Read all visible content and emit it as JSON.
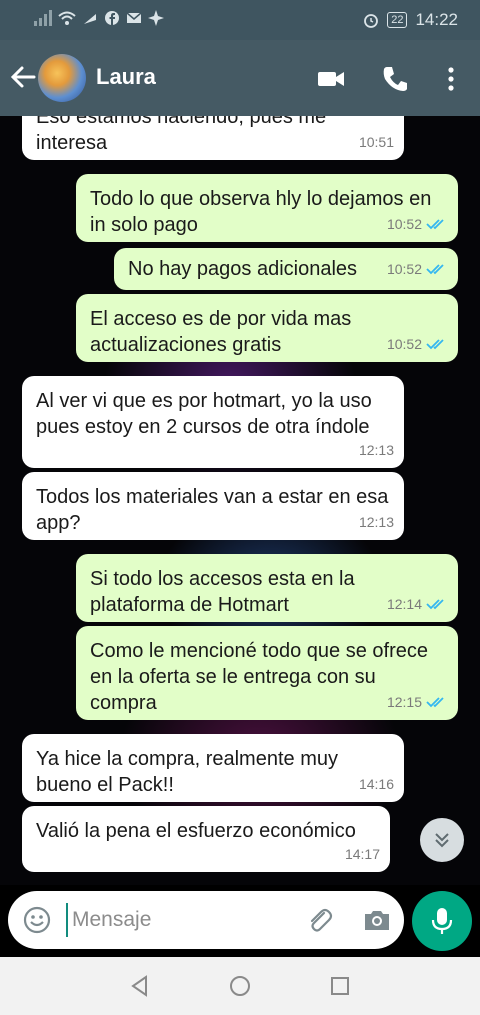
{
  "status_bar": {
    "time": "14:22",
    "battery": "22"
  },
  "header": {
    "contact_name": "Laura"
  },
  "messages": [
    {
      "text": "Eso estamos haciendo, pues me interesa",
      "time": "10:51",
      "direction": "in"
    },
    {
      "text": "Todo lo que observa hly lo dejamos en in solo pago",
      "time": "10:52",
      "direction": "out",
      "status": "read"
    },
    {
      "text": "No hay pagos adicionales",
      "time": "10:52",
      "direction": "out",
      "status": "read"
    },
    {
      "text": "El acceso es de por vida mas actualizaciones gratis",
      "time": "10:52",
      "direction": "out",
      "status": "read"
    },
    {
      "text": "Al ver vi que es por hotmart, yo la uso pues estoy en 2 cursos de otra índole",
      "time": "12:13",
      "direction": "in"
    },
    {
      "text": "Todos los materiales van a estar en esa app?",
      "time": "12:13",
      "direction": "in"
    },
    {
      "text": "Si todo los accesos esta en la plataforma de Hotmart",
      "time": "12:14",
      "direction": "out",
      "status": "read"
    },
    {
      "text": "Como le mencioné todo que se ofrece en la oferta se le entrega con su compra",
      "time": "12:15",
      "direction": "out",
      "status": "read"
    },
    {
      "text": "Ya hice la compra, realmente muy bueno el Pack!!",
      "time": "14:16",
      "direction": "in"
    },
    {
      "text": "Valió la pena el esfuerzo económico",
      "time": "14:17",
      "direction": "in"
    }
  ],
  "composer": {
    "placeholder": "Mensaje"
  },
  "colors": {
    "header": "#455a64",
    "outgoing_bubble": "#e2fec8",
    "incoming_bubble": "#ffffff",
    "read_ticks": "#34b7f1",
    "mic_button": "#00a884"
  }
}
